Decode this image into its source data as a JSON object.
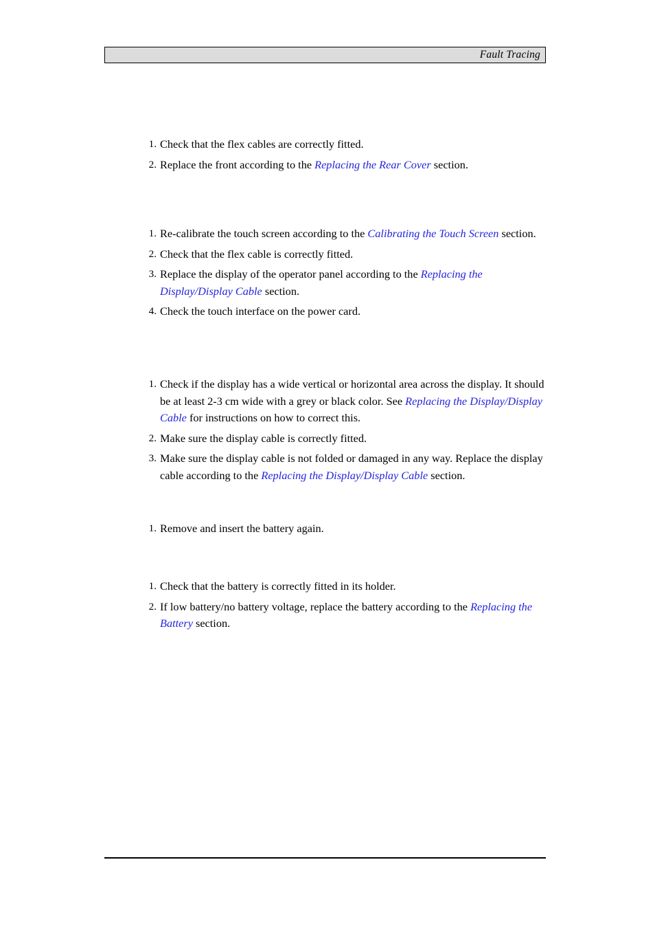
{
  "header": {
    "title": "Fault Tracing"
  },
  "link_color": "#2222dd",
  "header_bg_color": "#dcdcdc",
  "lists": [
    {
      "id": "group-1",
      "items": [
        {
          "num": "1.",
          "parts": [
            {
              "text": "Check that the flex cables are correctly fitted.",
              "style": "plain"
            }
          ]
        },
        {
          "num": "2.",
          "parts": [
            {
              "text": "Replace the front according to the ",
              "style": "plain"
            },
            {
              "text": "Replacing the Rear Cover",
              "style": "xref"
            },
            {
              "text": " section.",
              "style": "plain"
            }
          ]
        }
      ]
    },
    {
      "id": "group-2",
      "items": [
        {
          "num": "1.",
          "parts": [
            {
              "text": "Re-calibrate the touch screen according to the ",
              "style": "plain"
            },
            {
              "text": "Calibrating the Touch Screen",
              "style": "xref"
            },
            {
              "text": " section.",
              "style": "plain"
            }
          ]
        },
        {
          "num": "2.",
          "parts": [
            {
              "text": "Check that the flex cable is correctly fitted.",
              "style": "plain"
            }
          ]
        },
        {
          "num": "3.",
          "parts": [
            {
              "text": "Replace the display of the operator panel according to the ",
              "style": "plain"
            },
            {
              "text": "Replacing the Display/Display Cable",
              "style": "xref"
            },
            {
              "text": " section.",
              "style": "plain"
            }
          ]
        },
        {
          "num": "4.",
          "parts": [
            {
              "text": "Check the touch interface on the power card.",
              "style": "plain"
            }
          ]
        }
      ]
    },
    {
      "id": "group-3",
      "items": [
        {
          "num": "1.",
          "parts": [
            {
              "text": "Check if the display has a wide vertical or horizontal area across the display.  It should be at least 2-3 cm wide with a grey or black color.  See ",
              "style": "plain"
            },
            {
              "text": "Replacing the Display/Display Cable",
              "style": "xref"
            },
            {
              "text": " for instructions on how to correct this.",
              "style": "plain"
            }
          ]
        },
        {
          "num": "2.",
          "parts": [
            {
              "text": "Make sure the display cable is correctly fitted.",
              "style": "plain"
            }
          ]
        },
        {
          "num": "3.",
          "parts": [
            {
              "text": "Make sure the display cable is not folded or damaged in any way.  Replace the display cable according to the ",
              "style": "plain"
            },
            {
              "text": "Replacing the Display/Display Cable",
              "style": "xref"
            },
            {
              "text": " section.",
              "style": "plain"
            }
          ]
        }
      ]
    },
    {
      "id": "group-4",
      "items": [
        {
          "num": "1.",
          "parts": [
            {
              "text": "Remove and insert the battery again.",
              "style": "plain"
            }
          ]
        }
      ]
    },
    {
      "id": "group-5",
      "items": [
        {
          "num": "1.",
          "parts": [
            {
              "text": "Check that the battery is correctly fitted in its holder.",
              "style": "plain"
            }
          ]
        },
        {
          "num": "2.",
          "parts": [
            {
              "text": "If low battery/no battery voltage, replace the battery according to the ",
              "style": "plain"
            },
            {
              "text": "Replacing the Battery",
              "style": "xref"
            },
            {
              "text": " section.",
              "style": "plain"
            }
          ]
        }
      ]
    }
  ]
}
